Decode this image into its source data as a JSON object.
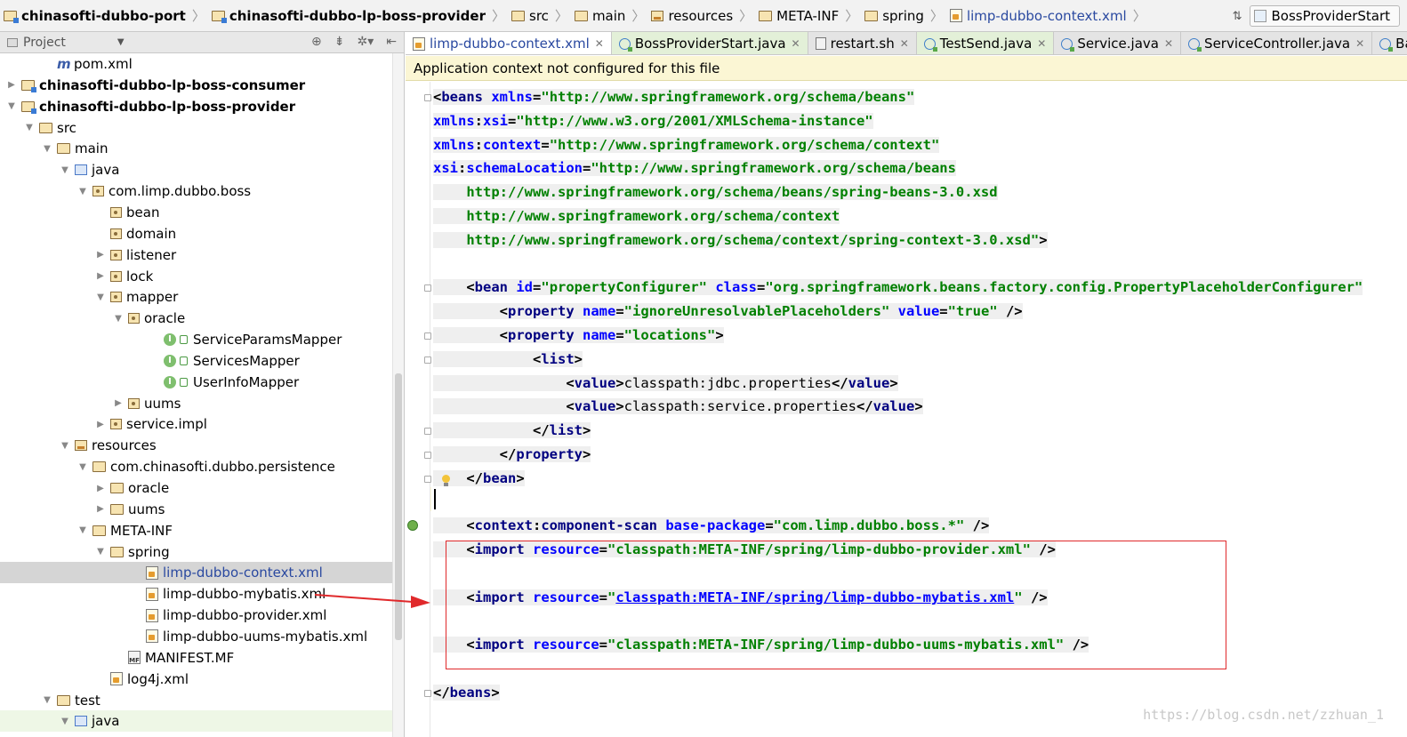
{
  "breadcrumbs": [
    {
      "label": "chinasofti-dubbo-port",
      "icon": "module-icon",
      "bold": true
    },
    {
      "label": "chinasofti-dubbo-lp-boss-provider",
      "icon": "module-icon",
      "bold": true
    },
    {
      "label": "src",
      "icon": "folder-icon"
    },
    {
      "label": "main",
      "icon": "folder-icon"
    },
    {
      "label": "resources",
      "icon": "resources-folder-icon"
    },
    {
      "label": "META-INF",
      "icon": "folder-icon"
    },
    {
      "label": "spring",
      "icon": "folder-icon"
    },
    {
      "label": "limp-dubbo-context.xml",
      "icon": "xml-file-icon"
    }
  ],
  "run_config": {
    "label": "BossProviderStart"
  },
  "project_panel": {
    "title": "Project"
  },
  "tree": [
    {
      "label": "pom.xml",
      "icon": "maven-icon",
      "depth": 3
    },
    {
      "label": "chinasofti-dubbo-lp-boss-consumer",
      "icon": "module-icon",
      "depth": 1,
      "arrow": "collapsed",
      "bold": true
    },
    {
      "label": "chinasofti-dubbo-lp-boss-provider",
      "icon": "module-icon",
      "depth": 1,
      "arrow": "expanded",
      "bold": true
    },
    {
      "label": "src",
      "icon": "folder-icon",
      "depth": 2,
      "arrow": "expanded"
    },
    {
      "label": "main",
      "icon": "folder-icon",
      "depth": 3,
      "arrow": "expanded"
    },
    {
      "label": "java",
      "icon": "source-folder-icon",
      "depth": 4,
      "arrow": "expanded"
    },
    {
      "label": "com.limp.dubbo.boss",
      "icon": "package-icon",
      "depth": 5,
      "arrow": "expanded"
    },
    {
      "label": "bean",
      "icon": "package-icon",
      "depth": 6
    },
    {
      "label": "domain",
      "icon": "package-icon",
      "depth": 6
    },
    {
      "label": "listener",
      "icon": "package-icon",
      "depth": 6,
      "arrow": "collapsed"
    },
    {
      "label": "lock",
      "icon": "package-icon",
      "depth": 6,
      "arrow": "collapsed"
    },
    {
      "label": "mapper",
      "icon": "package-icon",
      "depth": 6,
      "arrow": "expanded"
    },
    {
      "label": "oracle",
      "icon": "package-icon",
      "depth": 7,
      "arrow": "expanded"
    },
    {
      "label": "ServiceParamsMapper",
      "icon": "interface-icon",
      "depth": 9
    },
    {
      "label": "ServicesMapper",
      "icon": "interface-icon",
      "depth": 9
    },
    {
      "label": "UserInfoMapper",
      "icon": "interface-icon",
      "depth": 9
    },
    {
      "label": "uums",
      "icon": "package-icon",
      "depth": 7,
      "arrow": "collapsed"
    },
    {
      "label": "service.impl",
      "icon": "package-icon",
      "depth": 6,
      "arrow": "collapsed"
    },
    {
      "label": "resources",
      "icon": "resources-folder-icon",
      "depth": 4,
      "arrow": "expanded"
    },
    {
      "label": "com.chinasofti.dubbo.persistence",
      "icon": "folder-icon",
      "depth": 5,
      "arrow": "expanded"
    },
    {
      "label": "oracle",
      "icon": "folder-icon",
      "depth": 6,
      "arrow": "collapsed"
    },
    {
      "label": "uums",
      "icon": "folder-icon",
      "depth": 6,
      "arrow": "collapsed"
    },
    {
      "label": "META-INF",
      "icon": "folder-icon",
      "depth": 5,
      "arrow": "expanded"
    },
    {
      "label": "spring",
      "icon": "folder-icon",
      "depth": 6,
      "arrow": "expanded"
    },
    {
      "label": "limp-dubbo-context.xml",
      "icon": "xml-file-icon",
      "depth": 8,
      "selected": true
    },
    {
      "label": "limp-dubbo-mybatis.xml",
      "icon": "xml-file-icon",
      "depth": 8
    },
    {
      "label": "limp-dubbo-provider.xml",
      "icon": "xml-file-icon",
      "depth": 8
    },
    {
      "label": "limp-dubbo-uums-mybatis.xml",
      "icon": "xml-file-icon",
      "depth": 8
    },
    {
      "label": "MANIFEST.MF",
      "icon": "manifest-icon",
      "depth": 7
    },
    {
      "label": "log4j.xml",
      "icon": "xml-file-icon",
      "depth": 6
    },
    {
      "label": "test",
      "icon": "folder-icon",
      "depth": 3,
      "arrow": "expanded"
    },
    {
      "label": "java",
      "icon": "test-source-folder-icon",
      "depth": 4,
      "arrow": "expanded",
      "highlight": true
    }
  ],
  "tabs": [
    {
      "label": "limp-dubbo-context.xml",
      "icon": "xml-file-icon",
      "active": true
    },
    {
      "label": "BossProviderStart.java",
      "icon": "class-icon",
      "green": true
    },
    {
      "label": "restart.sh",
      "icon": "shell-file-icon"
    },
    {
      "label": "TestSend.java",
      "icon": "class-icon",
      "green": true
    },
    {
      "label": "Service.java",
      "icon": "class-icon"
    },
    {
      "label": "ServiceController.java",
      "icon": "class-icon"
    },
    {
      "label": "Base",
      "icon": "class-icon"
    }
  ],
  "notice": "Application context not configured for this file",
  "code_lines": [
    {
      "shade": true,
      "tokens": [
        [
          "p",
          "<"
        ],
        [
          "t",
          "beans "
        ],
        [
          "a",
          "xmlns"
        ],
        [
          "p",
          "="
        ],
        [
          "s",
          "\"http://www.springframework.org/schema/beans\""
        ]
      ]
    },
    {
      "shade": true,
      "tokens": [
        [
          "a",
          "xmlns"
        ],
        [
          "p",
          ":"
        ],
        [
          "a",
          "xsi"
        ],
        [
          "p",
          "="
        ],
        [
          "s",
          "\"http://www.w3.org/2001/XMLSchema-instance\""
        ]
      ]
    },
    {
      "shade": true,
      "tokens": [
        [
          "a",
          "xmlns"
        ],
        [
          "p",
          ":"
        ],
        [
          "a",
          "context"
        ],
        [
          "p",
          "="
        ],
        [
          "s",
          "\"http://www.springframework.org/schema/context\""
        ]
      ]
    },
    {
      "shade": true,
      "tokens": [
        [
          "a",
          "xsi"
        ],
        [
          "p",
          ":"
        ],
        [
          "a",
          "schemaLocation"
        ],
        [
          "p",
          "="
        ],
        [
          "s",
          "\"http://www.springframework.org/schema/beans"
        ]
      ]
    },
    {
      "shade": true,
      "tokens": [
        [
          "s",
          "    http://www.springframework.org/schema/beans/spring-beans-3.0.xsd"
        ]
      ]
    },
    {
      "shade": true,
      "tokens": [
        [
          "s",
          "    http://www.springframework.org/schema/context"
        ]
      ]
    },
    {
      "shade": true,
      "tokens": [
        [
          "s",
          "    http://www.springframework.org/schema/context/spring-context-3.0.xsd\""
        ],
        [
          "p",
          ">"
        ]
      ]
    },
    {
      "tokens": []
    },
    {
      "shade": true,
      "tokens": [
        [
          "n",
          "    "
        ],
        [
          "p",
          "<"
        ],
        [
          "t",
          "bean "
        ],
        [
          "a",
          "id"
        ],
        [
          "p",
          "="
        ],
        [
          "s",
          "\"propertyConfigurer\" "
        ],
        [
          "a",
          "class"
        ],
        [
          "p",
          "="
        ],
        [
          "s",
          "\"org.springframework.beans.factory.config.PropertyPlaceholderConfigurer\""
        ]
      ]
    },
    {
      "shade": true,
      "tokens": [
        [
          "n",
          "        "
        ],
        [
          "p",
          "<"
        ],
        [
          "t",
          "property "
        ],
        [
          "a",
          "name"
        ],
        [
          "p",
          "="
        ],
        [
          "s",
          "\"ignoreUnresolvablePlaceholders\" "
        ],
        [
          "a",
          "value"
        ],
        [
          "p",
          "="
        ],
        [
          "s",
          "\"true\" "
        ],
        [
          "p",
          "/>"
        ]
      ]
    },
    {
      "shade": true,
      "tokens": [
        [
          "n",
          "        "
        ],
        [
          "p",
          "<"
        ],
        [
          "t",
          "property "
        ],
        [
          "a",
          "name"
        ],
        [
          "p",
          "="
        ],
        [
          "s",
          "\"locations\""
        ],
        [
          "p",
          ">"
        ]
      ]
    },
    {
      "shade": true,
      "tokens": [
        [
          "n",
          "            "
        ],
        [
          "p",
          "<"
        ],
        [
          "t",
          "list"
        ],
        [
          "p",
          ">"
        ]
      ]
    },
    {
      "shade": true,
      "tokens": [
        [
          "n",
          "                "
        ],
        [
          "p",
          "<"
        ],
        [
          "t",
          "value"
        ],
        [
          "p",
          ">"
        ],
        [
          "n",
          "classpath:jdbc.properties"
        ],
        [
          "p",
          "</"
        ],
        [
          "t",
          "value"
        ],
        [
          "p",
          ">"
        ]
      ]
    },
    {
      "shade": true,
      "tokens": [
        [
          "n",
          "                "
        ],
        [
          "p",
          "<"
        ],
        [
          "t",
          "value"
        ],
        [
          "p",
          ">"
        ],
        [
          "n",
          "classpath:service.properties"
        ],
        [
          "p",
          "</"
        ],
        [
          "t",
          "value"
        ],
        [
          "p",
          ">"
        ]
      ]
    },
    {
      "shade": true,
      "tokens": [
        [
          "n",
          "            "
        ],
        [
          "p",
          "</"
        ],
        [
          "t",
          "list"
        ],
        [
          "p",
          ">"
        ]
      ]
    },
    {
      "shade": true,
      "tokens": [
        [
          "n",
          "        "
        ],
        [
          "p",
          "</"
        ],
        [
          "t",
          "property"
        ],
        [
          "p",
          ">"
        ]
      ]
    },
    {
      "shade": true,
      "tokens": [
        [
          "n",
          "    "
        ],
        [
          "p",
          "</"
        ],
        [
          "t",
          "bean"
        ],
        [
          "p",
          ">"
        ]
      ]
    },
    {
      "tokens": []
    },
    {
      "shade": true,
      "tokens": [
        [
          "n",
          "    "
        ],
        [
          "p",
          "<"
        ],
        [
          "t",
          "context"
        ],
        [
          "p",
          ":"
        ],
        [
          "t",
          "component-scan "
        ],
        [
          "a",
          "base-package"
        ],
        [
          "p",
          "="
        ],
        [
          "s",
          "\"com.limp.dubbo.boss.*\" "
        ],
        [
          "p",
          "/>"
        ]
      ]
    },
    {
      "shade": true,
      "tokens": [
        [
          "n",
          "    "
        ],
        [
          "p",
          "<"
        ],
        [
          "t",
          "import "
        ],
        [
          "a",
          "resource"
        ],
        [
          "p",
          "="
        ],
        [
          "s",
          "\"classpath:META-INF/spring/limp-dubbo-provider.xml\" "
        ],
        [
          "p",
          "/>"
        ]
      ]
    },
    {
      "tokens": []
    },
    {
      "shade": true,
      "tokens": [
        [
          "n",
          "    "
        ],
        [
          "p",
          "<"
        ],
        [
          "t",
          "import "
        ],
        [
          "a",
          "resource"
        ],
        [
          "p",
          "="
        ],
        [
          "s",
          "\""
        ],
        [
          "u",
          "classpath:META-INF/spring/limp-dubbo-mybatis.xml"
        ],
        [
          "s",
          "\" "
        ],
        [
          "p",
          "/>"
        ]
      ]
    },
    {
      "tokens": []
    },
    {
      "shade": true,
      "tokens": [
        [
          "n",
          "    "
        ],
        [
          "p",
          "<"
        ],
        [
          "t",
          "import "
        ],
        [
          "a",
          "resource"
        ],
        [
          "p",
          "="
        ],
        [
          "s",
          "\"classpath:META-INF/spring/limp-dubbo-uums-mybatis.xml\" "
        ],
        [
          "p",
          "/>"
        ]
      ]
    },
    {
      "tokens": []
    },
    {
      "shade": true,
      "tokens": [
        [
          "p",
          "</"
        ],
        [
          "t",
          "beans"
        ],
        [
          "p",
          ">"
        ]
      ]
    }
  ],
  "watermark": "https://blog.csdn.net/zzhuan_1"
}
